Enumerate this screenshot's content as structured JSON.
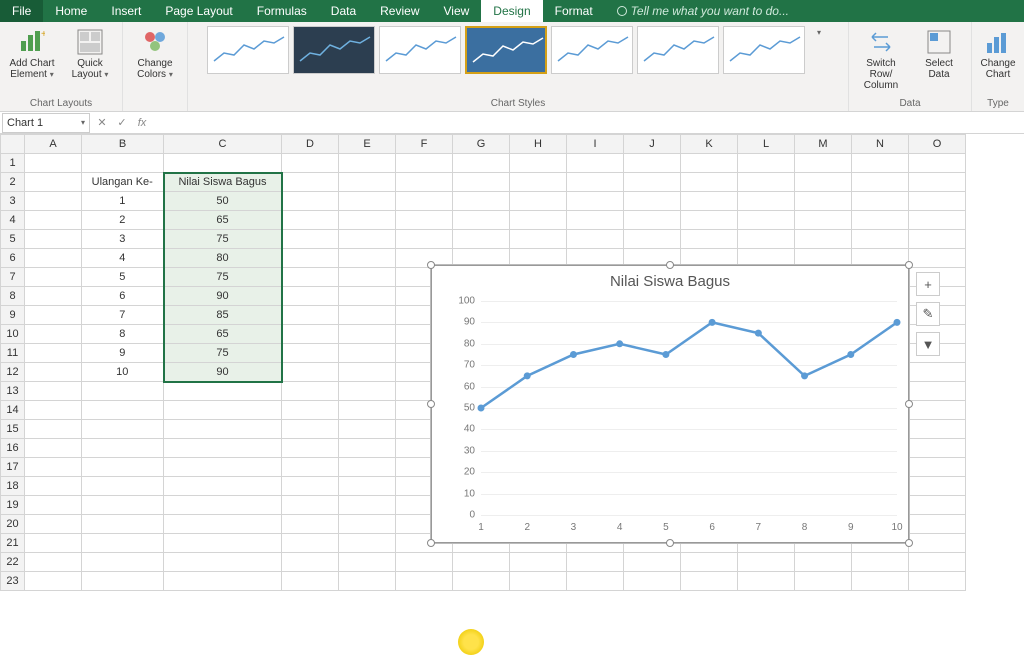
{
  "tabs": {
    "file": "File",
    "home": "Home",
    "insert": "Insert",
    "page_layout": "Page Layout",
    "formulas": "Formulas",
    "data": "Data",
    "review": "Review",
    "view": "View",
    "design": "Design",
    "format": "Format",
    "tell_me": "Tell me what you want to do..."
  },
  "ribbon": {
    "chart_layouts": {
      "add_chart_element": "Add Chart Element",
      "quick_layout": "Quick Layout",
      "group_label": "Chart Layouts"
    },
    "change_colors": "Change Colors",
    "chart_styles_label": "Chart Styles",
    "data_group": {
      "switch": "Switch Row/ Column",
      "select": "Select Data",
      "label": "Data"
    },
    "type_group": {
      "change": "Change Chart",
      "label": "Type"
    }
  },
  "namebox": "Chart 1",
  "fx_label": "fx",
  "columns": [
    "A",
    "B",
    "C",
    "D",
    "E",
    "F",
    "G",
    "H",
    "I",
    "J",
    "K",
    "L",
    "M",
    "N",
    "O"
  ],
  "rows": [
    "1",
    "2",
    "3",
    "4",
    "5",
    "6",
    "7",
    "8",
    "9",
    "10",
    "11",
    "12",
    "13",
    "14",
    "15",
    "16",
    "17",
    "18",
    "19",
    "20",
    "21",
    "22",
    "23"
  ],
  "headers": {
    "b": "Ulangan Ke-",
    "c": "Nilai Siswa Bagus"
  },
  "data_rows": [
    {
      "b": "1",
      "c": "50"
    },
    {
      "b": "2",
      "c": "65"
    },
    {
      "b": "3",
      "c": "75"
    },
    {
      "b": "4",
      "c": "80"
    },
    {
      "b": "5",
      "c": "75"
    },
    {
      "b": "6",
      "c": "90"
    },
    {
      "b": "7",
      "c": "85"
    },
    {
      "b": "8",
      "c": "65"
    },
    {
      "b": "9",
      "c": "75"
    },
    {
      "b": "10",
      "c": "90"
    }
  ],
  "chart": {
    "title": "Nilai Siswa Bagus",
    "side_buttons": {
      "plus": "+",
      "brush": "✎",
      "filter": "▼"
    }
  },
  "chart_data": {
    "type": "line",
    "title": "Nilai Siswa Bagus",
    "xlabel": "",
    "ylabel": "",
    "categories": [
      1,
      2,
      3,
      4,
      5,
      6,
      7,
      8,
      9,
      10
    ],
    "values": [
      50,
      65,
      75,
      80,
      75,
      90,
      85,
      65,
      75,
      90
    ],
    "ylim": [
      0,
      100
    ],
    "yticks": [
      0,
      10,
      20,
      30,
      40,
      50,
      60,
      70,
      80,
      90,
      100
    ],
    "series": [
      {
        "name": "Nilai Siswa Bagus",
        "values": [
          50,
          65,
          75,
          80,
          75,
          90,
          85,
          65,
          75,
          90
        ]
      }
    ]
  }
}
